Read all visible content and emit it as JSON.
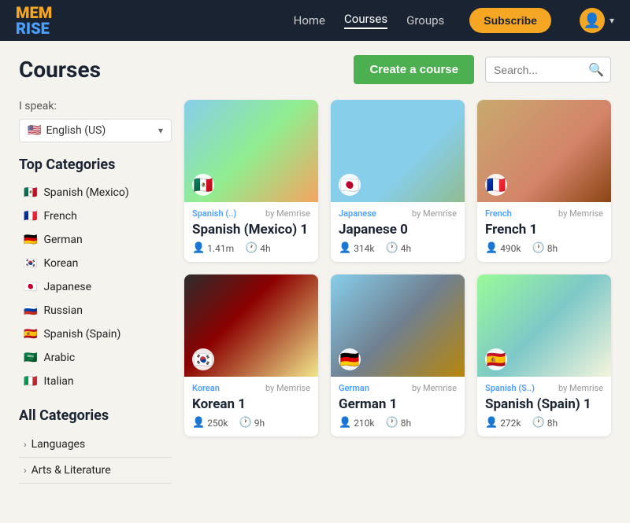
{
  "navbar": {
    "logo_mem": "MEM",
    "logo_rise": "RISE",
    "links": [
      {
        "label": "Home",
        "active": false
      },
      {
        "label": "Courses",
        "active": true
      },
      {
        "label": "Groups",
        "active": false
      }
    ],
    "subscribe_label": "Subscribe",
    "avatar_icon": "👤"
  },
  "header": {
    "title": "Courses",
    "create_button": "Create a course",
    "search_placeholder": "Search..."
  },
  "sidebar": {
    "i_speak_label": "I speak:",
    "language": "English (US)",
    "language_flag": "🇺🇸",
    "top_categories_title": "Top Categories",
    "categories": [
      {
        "label": "Spanish (Mexico)",
        "flag": "🇲🇽",
        "active": false
      },
      {
        "label": "French",
        "flag": "🇫🇷",
        "active": false
      },
      {
        "label": "German",
        "flag": "🇩🇪",
        "active": false
      },
      {
        "label": "Korean",
        "flag": "🇰🇷",
        "active": false
      },
      {
        "label": "Japanese",
        "flag": "🇯🇵",
        "active": false
      },
      {
        "label": "Russian",
        "flag": "🇷🇺",
        "active": false
      },
      {
        "label": "Spanish (Spain)",
        "flag": "🇪🇸",
        "active": false
      },
      {
        "label": "Arabic",
        "flag": "🇸🇦",
        "active": false
      },
      {
        "label": "Italian",
        "flag": "🇮🇹",
        "active": false
      }
    ],
    "all_categories_title": "All Categories",
    "all_categories": [
      {
        "label": "Languages"
      },
      {
        "label": "Arts & Literature"
      }
    ]
  },
  "courses": [
    {
      "lang": "Spanish (..)",
      "by": "by Memrise",
      "name": "Spanish (Mexico) 1",
      "flag": "🇲🇽",
      "students": "1.41m",
      "hours": "4h",
      "bg": "img-mexico"
    },
    {
      "lang": "Japanese",
      "by": "by Memrise",
      "name": "Japanese 0",
      "flag": "🇯🇵",
      "students": "314k",
      "hours": "4h",
      "bg": "img-japan"
    },
    {
      "lang": "French",
      "by": "by Memrise",
      "name": "French 1",
      "flag": "🇫🇷",
      "students": "490k",
      "hours": "8h",
      "bg": "img-french"
    },
    {
      "lang": "Korean",
      "by": "by Memrise",
      "name": "Korean 1",
      "flag": "🇰🇷",
      "students": "250k",
      "hours": "9h",
      "bg": "img-korean"
    },
    {
      "lang": "German",
      "by": "by Memrise",
      "name": "German 1",
      "flag": "🇩🇪",
      "students": "210k",
      "hours": "8h",
      "bg": "img-german"
    },
    {
      "lang": "Spanish (S..)",
      "by": "by Memrise",
      "name": "Spanish (Spain) 1",
      "flag": "🇪🇸",
      "students": "272k",
      "hours": "8h",
      "bg": "img-spanish-spain"
    }
  ]
}
